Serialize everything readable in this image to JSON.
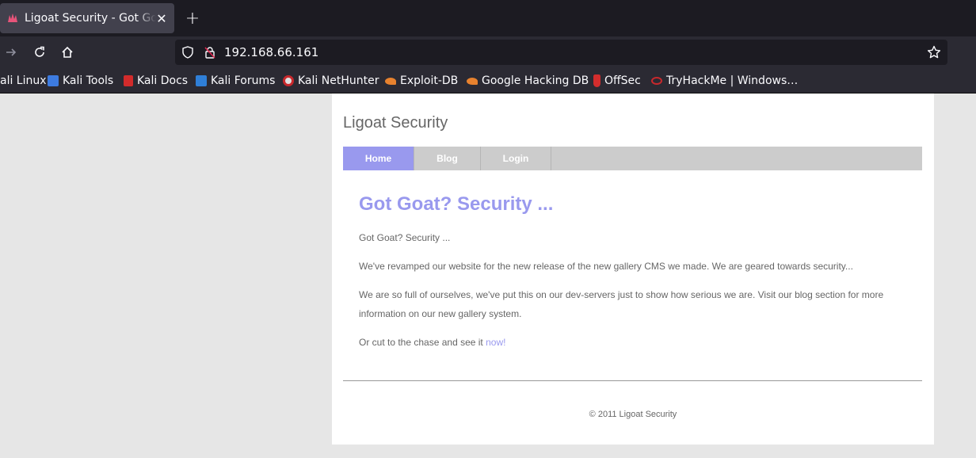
{
  "browser": {
    "tab": {
      "title": "Ligoat Security - Got Goat? Security ...",
      "favicon": "kali-dragon-icon"
    },
    "url": "192.168.66.161",
    "bookmarks": [
      {
        "label": "ali Linux",
        "icon": "kali-icon"
      },
      {
        "label": "Kali Tools",
        "icon": "kali-tools-icon"
      },
      {
        "label": "Kali Docs",
        "icon": "kali-docs-icon"
      },
      {
        "label": "Kali Forums",
        "icon": "kali-forums-icon"
      },
      {
        "label": "Kali NetHunter",
        "icon": "nethunter-icon"
      },
      {
        "label": "Exploit-DB",
        "icon": "exploit-db-icon"
      },
      {
        "label": "Google Hacking DB",
        "icon": "ghdb-icon"
      },
      {
        "label": "OffSec",
        "icon": "offsec-icon"
      },
      {
        "label": "TryHackMe | Windows…",
        "icon": "tryhackme-icon"
      }
    ]
  },
  "site": {
    "title": "Ligoat Security",
    "menu": [
      {
        "label": "Home",
        "active": true
      },
      {
        "label": "Blog",
        "active": false
      },
      {
        "label": "Login",
        "active": false
      }
    ],
    "headline": "Got Goat? Security ...",
    "paragraphs": [
      "Got Goat? Security ...",
      "We've revamped our website for the new release of the new gallery CMS we made. We are geared towards security...",
      "We are so full of ourselves, we've put this on our dev-servers just to show how serious we are. Visit our blog section for more information on our new gallery system."
    ],
    "cta_text": "Or cut to the chase and see it ",
    "cta_link": "now!",
    "footer": "© 2011 Ligoat Security"
  },
  "colors": {
    "accent": "#9999ee",
    "text": "#666666",
    "menu_bg": "#cccccc"
  }
}
